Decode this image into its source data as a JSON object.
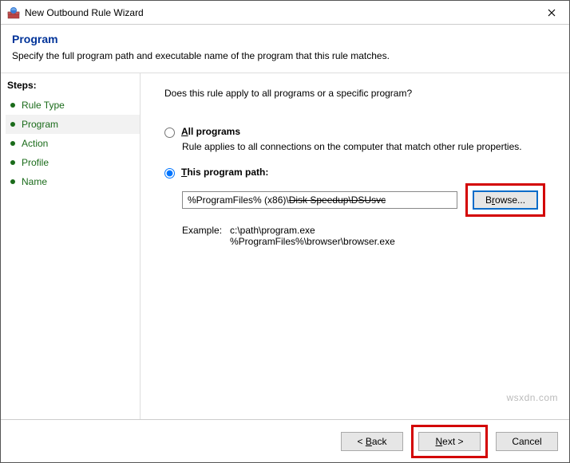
{
  "window": {
    "title": "New Outbound Rule Wizard"
  },
  "header": {
    "title": "Program",
    "desc": "Specify the full program path and executable name of the program that this rule matches."
  },
  "sidebar": {
    "steps_label": "Steps:",
    "items": [
      {
        "label": "Rule Type"
      },
      {
        "label": "Program"
      },
      {
        "label": "Action"
      },
      {
        "label": "Profile"
      },
      {
        "label": "Name"
      }
    ],
    "active_index": 1
  },
  "main": {
    "question": "Does this rule apply to all programs or a specific program?",
    "opt_all": {
      "label_pre": "A",
      "label_rest": "ll programs",
      "sub": "Rule applies to all connections on the computer that match other rule properties."
    },
    "opt_path": {
      "label_pre": "T",
      "label_rest": "his program path:",
      "value_plain": "%ProgramFiles% (x86)\\",
      "value_strike": "Disk Speedup\\DSUsvc",
      "browse": "Browse...",
      "example_label": "Example:",
      "example1": "c:\\path\\program.exe",
      "example2": "%ProgramFiles%\\browser\\browser.exe"
    }
  },
  "footer": {
    "back": "< Back",
    "next": "Next >",
    "cancel": "Cancel"
  },
  "watermark": "wsxdn.com"
}
